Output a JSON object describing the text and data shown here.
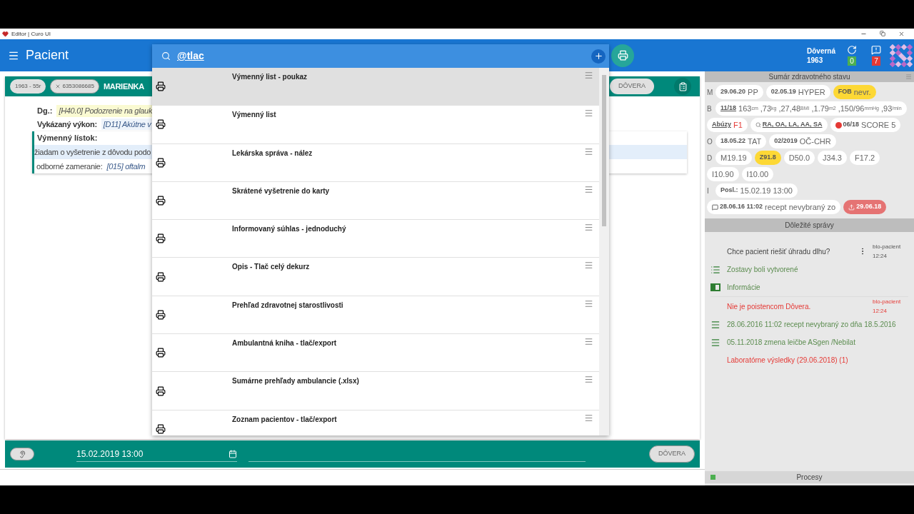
{
  "window": {
    "title": "Editor | Curo UI"
  },
  "header": {
    "title": "Pacient",
    "search": {
      "value": "@tlac"
    },
    "insurer": "Dôverná",
    "year": "1963",
    "sync_count": "0",
    "message_count": "7"
  },
  "patient": {
    "chips": [
      "1963 - 55r",
      "6353086685"
    ],
    "name": "MARIENKA",
    "insurer_button": "DÔVERA"
  },
  "record": {
    "diagnosis_label": "Dg.:",
    "diagnosis": "[H40.0] Podozrenie na glauk",
    "procedure_label": "Vykázaný výkon:",
    "procedure": "[D11] Akútne v",
    "referral_title": "Výmenný lístok:",
    "referral_text": "žiadam o vyšetrenie z dôvodu podo",
    "specialty_label": "odborné zameranie:",
    "specialty": "[015] oftalm"
  },
  "print_menu": {
    "items": [
      {
        "label": "Výmenný list - poukaz",
        "selected": true
      },
      {
        "label": "Výmenný list",
        "selected": false
      },
      {
        "label": "Lekárska správa - nález",
        "selected": false
      },
      {
        "label": "Skrátené vyšetrenie do karty",
        "selected": false
      },
      {
        "label": "Informovaný súhlas - jednoduchý",
        "selected": false
      },
      {
        "label": "Opis - Tlač celý dekurz",
        "selected": false
      },
      {
        "label": "Prehľad zdravotnej starostlivosti",
        "selected": false
      },
      {
        "label": "Ambulantná kniha - tlač/export",
        "selected": false
      },
      {
        "label": "Sumárne prehľady ambulancie (.xlsx)",
        "selected": false
      },
      {
        "label": "Zoznam pacientov - tlač/export",
        "selected": false
      }
    ]
  },
  "footer": {
    "date": "15.02.2019 13:00",
    "insurer_button": "DÔVERA"
  },
  "summary": {
    "title": "Sumár zdravotného stavu",
    "rows": [
      {
        "label": "M",
        "chips": [
          {
            "kind": "plain",
            "segments": [
              {
                "text": "29.06.20",
                "kind": "small"
              },
              {
                "text": "PP",
                "kind": "large"
              }
            ]
          },
          {
            "kind": "plain",
            "segments": [
              {
                "text": "02.05.19",
                "kind": "small"
              },
              {
                "text": "HYPER",
                "kind": "large"
              }
            ]
          },
          {
            "kind": "highlight",
            "segments": [
              {
                "text": "FOB",
                "kind": "small"
              },
              {
                "text": "nevr.",
                "kind": "large"
              }
            ]
          }
        ]
      },
      {
        "label": "B",
        "chips": [
          {
            "kind": "plain",
            "segments": [
              {
                "text": "11/18",
                "kind": "link"
              },
              {
                "text": "163",
                "kind": "large"
              },
              {
                "text": "cm",
                "kind": "unit"
              },
              {
                "text": ",73",
                "kind": "large"
              },
              {
                "text": "kg",
                "kind": "unit"
              },
              {
                "text": ",27,48",
                "kind": "large"
              },
              {
                "text": "BMI",
                "kind": "unit"
              },
              {
                "text": ",1.79",
                "kind": "large"
              },
              {
                "text": "m2",
                "kind": "unit"
              },
              {
                "text": ",150/96",
                "kind": "large"
              },
              {
                "text": "mmHg",
                "kind": "unit"
              },
              {
                "text": ",93",
                "kind": "large"
              },
              {
                "text": "/min",
                "kind": "unit"
              }
            ]
          }
        ]
      },
      {
        "chips": [
          {
            "kind": "plain",
            "segments": [
              {
                "text": "Abúzy",
                "kind": "link"
              },
              {
                "text": "F1",
                "kind": "alert"
              }
            ]
          },
          {
            "kind": "search",
            "segments": [
              {
                "text": "RA, OA, LA, AA, SA",
                "kind": "link"
              }
            ]
          },
          {
            "kind": "status",
            "segments": [
              {
                "text": "06/18",
                "kind": "small"
              },
              {
                "text": "SCORE 5",
                "kind": "large"
              }
            ]
          }
        ]
      },
      {
        "label": "O",
        "chips": [
          {
            "kind": "plain",
            "segments": [
              {
                "text": "18.05.22",
                "kind": "small"
              },
              {
                "text": "TAT",
                "kind": "large"
              }
            ]
          },
          {
            "kind": "plain",
            "segments": [
              {
                "text": "02/2019",
                "kind": "small"
              },
              {
                "text": "OČ-CHR",
                "kind": "large"
              }
            ]
          }
        ]
      },
      {
        "label": "D",
        "chips": [
          {
            "kind": "plain",
            "segments": [
              {
                "text": "M19.19",
                "kind": "large"
              }
            ]
          },
          {
            "kind": "highlight",
            "segments": [
              {
                "text": "Z91.8",
                "kind": "small"
              }
            ]
          },
          {
            "kind": "plain",
            "segments": [
              {
                "text": "D50.0",
                "kind": "large"
              }
            ]
          },
          {
            "kind": "plain",
            "segments": [
              {
                "text": "J34.3",
                "kind": "large"
              }
            ]
          },
          {
            "kind": "plain",
            "segments": [
              {
                "text": "F17.2",
                "kind": "large"
              }
            ]
          }
        ]
      },
      {
        "chips": [
          {
            "kind": "plain",
            "segments": [
              {
                "text": "I10.90",
                "kind": "large"
              }
            ]
          },
          {
            "kind": "plain",
            "segments": [
              {
                "text": "I10.00",
                "kind": "large"
              }
            ]
          }
        ]
      },
      {
        "label": "I",
        "chips": [
          {
            "kind": "plain",
            "segments": [
              {
                "text": "Posl.:",
                "kind": "small"
              },
              {
                "text": "15.02.19 13:00",
                "kind": "large"
              }
            ]
          }
        ]
      },
      {
        "chips": [
          {
            "kind": "comment",
            "segments": [
              {
                "text": "28.06.16 11:02",
                "kind": "small"
              },
              {
                "text": "recept nevybraný zo",
                "kind": "large"
              }
            ]
          },
          {
            "kind": "alert",
            "segments": [
              {
                "text": "29.06.18",
                "kind": "small"
              }
            ]
          }
        ]
      }
    ]
  },
  "messages": {
    "title": "Dôležité správy",
    "items": [
      {
        "kind": "question",
        "text": "Chce pacient riešiť úhradu dlhu?",
        "menu": true,
        "source": "blo-pacient",
        "time": "12:24"
      },
      {
        "kind": "list",
        "text": "Zostavy boli vytvorené",
        "menu": false
      },
      {
        "kind": "card",
        "text": "Informácie",
        "menu": false
      },
      {
        "kind": "warning",
        "text": "Nie je poistencom Dôvera.",
        "menu": false,
        "source": "blo-pacient",
        "time": "12:24"
      },
      {
        "kind": "lines",
        "text": "28.06.2016 11:02 recept nevybraný zo dňa 18.5.2016",
        "menu": false
      },
      {
        "kind": "lines",
        "text": "05.11.2018 zmena leičbe ASgen /Nebilat",
        "menu": false
      },
      {
        "kind": "warning",
        "text": "Laboratórne výsledky (29.06.2018) (1)",
        "menu": false
      }
    ]
  },
  "processes": {
    "title": "Procesy"
  }
}
